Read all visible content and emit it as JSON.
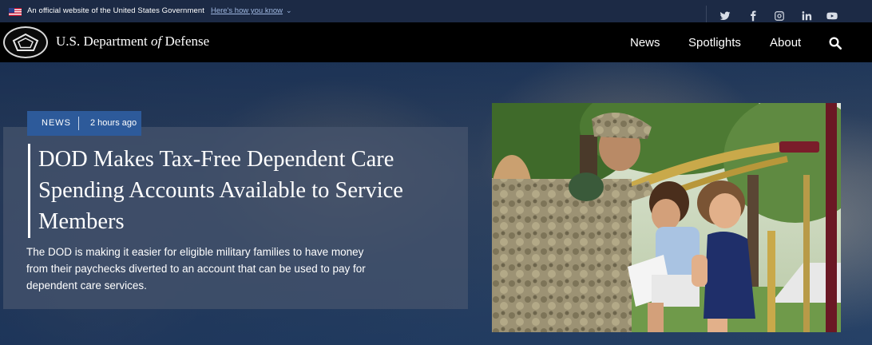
{
  "gov_banner": {
    "text": "An official website of the United States Government",
    "link": "Here's how you know"
  },
  "social": [
    "twitter-icon",
    "facebook-icon",
    "instagram-icon",
    "linkedin-icon",
    "youtube-icon"
  ],
  "header": {
    "title_pre": "U.S. Department ",
    "title_of": "of",
    "title_post": " Defense",
    "nav": [
      "News",
      "Spotlights",
      "About"
    ]
  },
  "hero": {
    "tag": "NEWS",
    "time": "2 hours ago",
    "headline": "DOD Makes Tax-Free Dependent Care Spending Accounts Available to Service Members",
    "summary": "The DOD is making it easier for eligible military families to have money from their paychecks diverted to an account that can be used to pay for dependent care services."
  },
  "colors": {
    "gov_banner_bg": "#1c2a45",
    "header_bg": "#000000",
    "tag_bg": "#2d5a9a",
    "link": "#9fb7e0"
  }
}
